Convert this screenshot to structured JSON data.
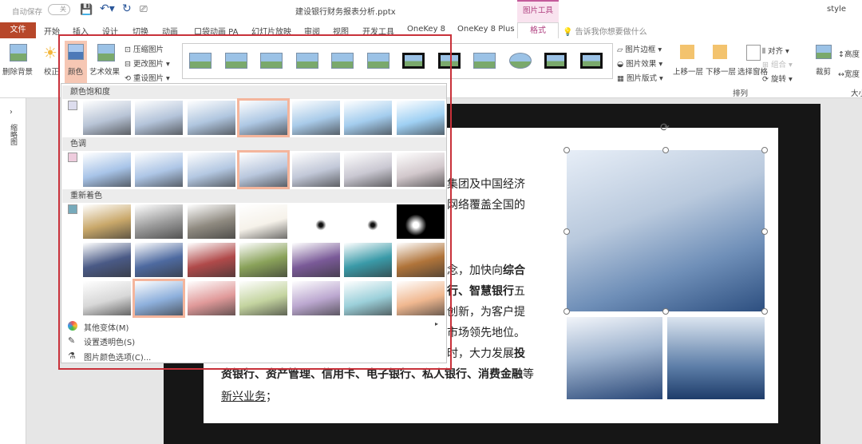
{
  "titlebar": {
    "autosave": "自动保存",
    "autosave_state": "关",
    "filename": "建设银行财务报表分析.pptx",
    "context_group": "图片工具",
    "user": "style"
  },
  "tabs": [
    "开始",
    "插入",
    "设计",
    "切换",
    "动画",
    "口袋动画 PA",
    "幻灯片放映",
    "审阅",
    "视图",
    "开发工具",
    "OneKey 8",
    "OneKey 8 Plus",
    "格式"
  ],
  "file_tab": "文件",
  "tell_me": "告诉我你想要做什么",
  "ribbon": {
    "remove_bg": "删除背景",
    "corrections": "校正",
    "color": "颜色",
    "artistic": "艺术效果",
    "compress": "压缩图片",
    "change": "更改图片",
    "reset": "重设图片",
    "border": "图片边框",
    "effects": "图片效果",
    "layout": "图片版式",
    "bring_forward": "上移一层",
    "send_backward": "下移一层",
    "selection_pane": "选择窗格",
    "align": "对齐",
    "group": "组合",
    "rotate": "旋转",
    "arrange_group": "排列",
    "crop": "裁剪",
    "height": "高度",
    "width": "宽度",
    "size_group": "大小"
  },
  "pane": {
    "label": "缩略图"
  },
  "dropdown": {
    "sections": [
      "颜色饱和度",
      "色调",
      "重新着色"
    ],
    "saturation": [
      "#b8c4d6",
      "#b4c4da",
      "#b0c6df",
      "#aec8e4",
      "#a9cbe9",
      "#a4cdee",
      "#9fd0f3"
    ],
    "tone": [
      "#a8c4e8",
      "#aec6e6",
      "#b4c8e2",
      "#bac8de",
      "#c2c8d8",
      "#cac8d2",
      "#d2c8cc"
    ],
    "recolor": [
      [
        "#c9a86a",
        "#9a9a9a",
        "#8f8a80",
        "#f6f2ea",
        "#ffffff",
        "#f2f2f2",
        "#000000"
      ],
      [
        "#4a5a86",
        "#4e6aa0",
        "#b04a4a",
        "#8aa25a",
        "#7a5a98",
        "#3a9aa8",
        "#b0743a"
      ],
      [
        "#d8d8d8",
        "#8eb0dc",
        "#e09a9a",
        "#c4d4a0",
        "#bca8d0",
        "#9cd0da",
        "#f0b890"
      ]
    ],
    "selected": {
      "saturation": 3,
      "tone": 3,
      "recolor": [
        2,
        1
      ]
    },
    "menu": [
      "其他变体(M)",
      "设置透明色(S)",
      "图片颜色选项(C)..."
    ]
  },
  "slide": {
    "lines": [
      {
        "parts": [
          {
            "t": "企业集团及中国经济",
            "b": false
          }
        ]
      },
      {
        "parts": [
          {
            "t": "营销网络覆盖全国的",
            "b": false
          }
        ]
      },
      {
        "parts": [
          {
            "t": "理念，加快向",
            "b": false
          },
          {
            "t": "综合",
            "b": true
          }
        ]
      },
      {
        "parts": [
          {
            "t": "银行、智慧银行",
            "b": true
          },
          {
            "t": "五",
            "b": false
          }
        ]
      },
      {
        "parts": [
          {
            "t": "的创新，为客户提",
            "b": false
          }
        ]
      },
      {
        "parts": [
          {
            "t": "于市场领先地位。",
            "b": false
          }
        ]
      },
      {
        "parts": [
          {
            "t": "同时，大力发展",
            "b": false
          },
          {
            "t": "投",
            "b": true
          }
        ]
      },
      {
        "parts": [
          {
            "t": "资银行、资产管理、信用卡、电子银行、私人银行、消费金融",
            "b": true
          },
          {
            "t": "等",
            "b": false
          }
        ]
      },
      {
        "parts": [
          {
            "t": "新兴业务",
            "b": false,
            "u": true
          },
          {
            "t": "；",
            "b": false
          }
        ]
      }
    ]
  }
}
